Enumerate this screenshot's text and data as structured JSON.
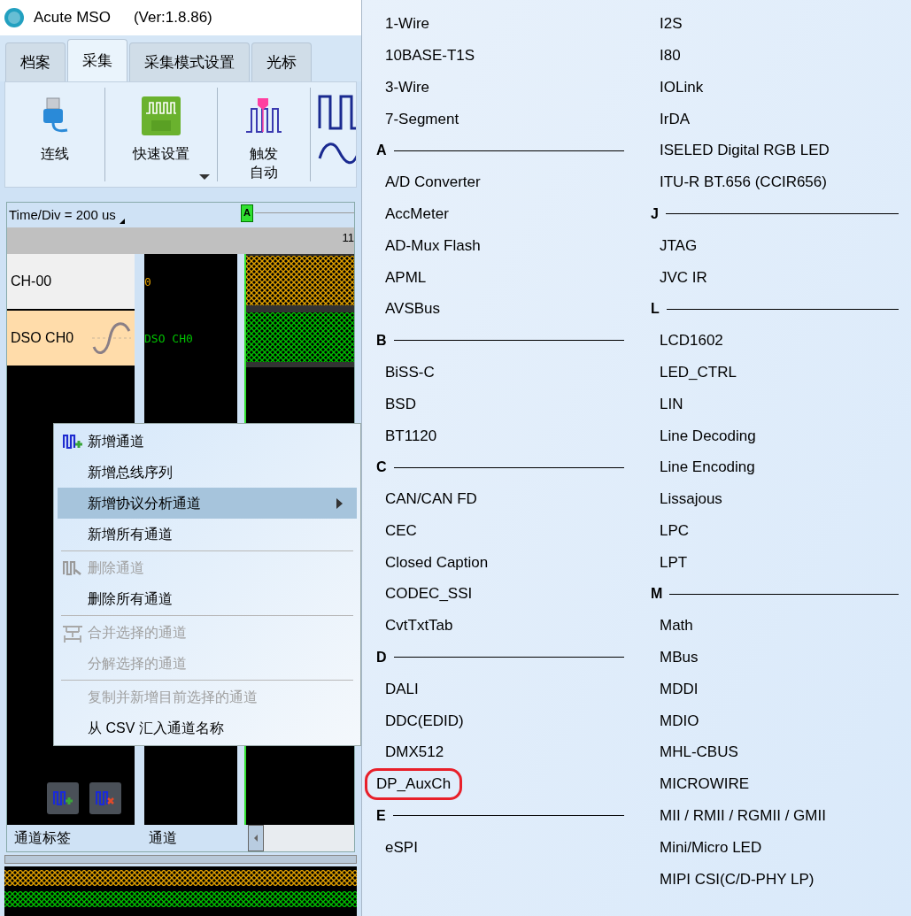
{
  "window": {
    "app_name": "Acute MSO",
    "version": "(Ver:1.8.86)"
  },
  "tabs": [
    {
      "label": "档案",
      "selected": false
    },
    {
      "label": "采集",
      "selected": true
    },
    {
      "label": "采集模式设置",
      "selected": false
    },
    {
      "label": "光标",
      "selected": false
    }
  ],
  "ribbon": [
    {
      "lines": [
        "连线"
      ],
      "has_dropdown": false
    },
    {
      "lines": [
        "快速设置"
      ],
      "has_dropdown": true
    },
    {
      "lines": [
        "触发",
        "自动"
      ],
      "has_dropdown": false
    }
  ],
  "scope": {
    "time_div": "Time/Div = 200 us",
    "ruler_label": "11",
    "marker": "A",
    "channels": [
      {
        "label": "CH-00",
        "kind": "digital",
        "name": "0",
        "color": "#e0a000",
        "selected": false
      },
      {
        "label": "DSO CH0",
        "kind": "analog",
        "name": "DSO CH0",
        "color": "#00c000",
        "selected": true
      }
    ],
    "footer": {
      "column_1": "通道标签",
      "column_2": "通道"
    }
  },
  "context_menu": [
    {
      "kind": "item",
      "label": "新增通道",
      "has_icon": true,
      "disabled": false,
      "selected": false,
      "has_submenu": false
    },
    {
      "kind": "item",
      "label": "新增总线序列",
      "has_icon": false,
      "disabled": false,
      "selected": false,
      "has_submenu": false
    },
    {
      "kind": "item",
      "label": "新增协议分析通道",
      "has_icon": false,
      "disabled": false,
      "selected": true,
      "has_submenu": true
    },
    {
      "kind": "item",
      "label": "新增所有通道",
      "has_icon": false,
      "disabled": false,
      "selected": false,
      "has_submenu": false
    },
    {
      "kind": "separator"
    },
    {
      "kind": "item",
      "label": "删除通道",
      "has_icon": true,
      "disabled": true,
      "selected": false,
      "has_submenu": false
    },
    {
      "kind": "item",
      "label": "删除所有通道",
      "has_icon": false,
      "disabled": false,
      "selected": false,
      "has_submenu": false
    },
    {
      "kind": "separator"
    },
    {
      "kind": "item",
      "label": "合并选择的通道",
      "has_icon": true,
      "disabled": true,
      "selected": false,
      "has_submenu": false
    },
    {
      "kind": "item",
      "label": "分解选择的通道",
      "has_icon": false,
      "disabled": true,
      "selected": false,
      "has_submenu": false
    },
    {
      "kind": "separator"
    },
    {
      "kind": "item",
      "label": "复制并新增目前选择的通道",
      "has_icon": false,
      "disabled": true,
      "selected": false,
      "has_submenu": false
    },
    {
      "kind": "item",
      "label": "从 CSV 汇入通道名称",
      "has_icon": false,
      "disabled": false,
      "selected": false,
      "has_submenu": false
    }
  ],
  "submenu": {
    "columns": [
      {
        "entries": [
          {
            "kind": "item",
            "label": "1-Wire",
            "circled": false
          },
          {
            "kind": "item",
            "label": "10BASE-T1S",
            "circled": false
          },
          {
            "kind": "item",
            "label": "3-Wire",
            "circled": false
          },
          {
            "kind": "item",
            "label": "7-Segment",
            "circled": false
          },
          {
            "kind": "header",
            "label": "A"
          },
          {
            "kind": "item",
            "label": "A/D Converter",
            "circled": false
          },
          {
            "kind": "item",
            "label": "AccMeter",
            "circled": false
          },
          {
            "kind": "item",
            "label": "AD-Mux Flash",
            "circled": false
          },
          {
            "kind": "item",
            "label": "APML",
            "circled": false
          },
          {
            "kind": "item",
            "label": "AVSBus",
            "circled": false
          },
          {
            "kind": "header",
            "label": "B"
          },
          {
            "kind": "item",
            "label": "BiSS-C",
            "circled": false
          },
          {
            "kind": "item",
            "label": "BSD",
            "circled": false
          },
          {
            "kind": "item",
            "label": "BT1120",
            "circled": false
          },
          {
            "kind": "header",
            "label": "C"
          },
          {
            "kind": "item",
            "label": "CAN/CAN FD",
            "circled": false
          },
          {
            "kind": "item",
            "label": "CEC",
            "circled": false
          },
          {
            "kind": "item",
            "label": "Closed Caption",
            "circled": false
          },
          {
            "kind": "item",
            "label": "CODEC_SSI",
            "circled": false
          },
          {
            "kind": "item",
            "label": "CvtTxtTab",
            "circled": false
          },
          {
            "kind": "header",
            "label": "D"
          },
          {
            "kind": "item",
            "label": "DALI",
            "circled": false
          },
          {
            "kind": "item",
            "label": "DDC(EDID)",
            "circled": false
          },
          {
            "kind": "item",
            "label": "DMX512",
            "circled": false
          },
          {
            "kind": "item",
            "label": "DP_AuxCh",
            "circled": true
          },
          {
            "kind": "header",
            "label": "E"
          },
          {
            "kind": "item",
            "label": "eSPI",
            "circled": false
          }
        ]
      },
      {
        "entries": [
          {
            "kind": "item",
            "label": "I2S",
            "circled": false
          },
          {
            "kind": "item",
            "label": "I80",
            "circled": false
          },
          {
            "kind": "item",
            "label": "IOLink",
            "circled": false
          },
          {
            "kind": "item",
            "label": "IrDA",
            "circled": false
          },
          {
            "kind": "item",
            "label": "ISELED Digital RGB LED",
            "circled": false
          },
          {
            "kind": "item",
            "label": "ITU-R BT.656 (CCIR656)",
            "circled": false
          },
          {
            "kind": "header",
            "label": "J"
          },
          {
            "kind": "item",
            "label": "JTAG",
            "circled": false
          },
          {
            "kind": "item",
            "label": "JVC IR",
            "circled": false
          },
          {
            "kind": "header",
            "label": "L"
          },
          {
            "kind": "item",
            "label": "LCD1602",
            "circled": false
          },
          {
            "kind": "item",
            "label": "LED_CTRL",
            "circled": false
          },
          {
            "kind": "item",
            "label": "LIN",
            "circled": false
          },
          {
            "kind": "item",
            "label": "Line Decoding",
            "circled": false
          },
          {
            "kind": "item",
            "label": "Line Encoding",
            "circled": false
          },
          {
            "kind": "item",
            "label": "Lissajous",
            "circled": false
          },
          {
            "kind": "item",
            "label": "LPC",
            "circled": false
          },
          {
            "kind": "item",
            "label": "LPT",
            "circled": false
          },
          {
            "kind": "header",
            "label": "M"
          },
          {
            "kind": "item",
            "label": "Math",
            "circled": false
          },
          {
            "kind": "item",
            "label": "MBus",
            "circled": false
          },
          {
            "kind": "item",
            "label": "MDDI",
            "circled": false
          },
          {
            "kind": "item",
            "label": "MDIO",
            "circled": false
          },
          {
            "kind": "item",
            "label": "MHL-CBUS",
            "circled": false
          },
          {
            "kind": "item",
            "label": "MICROWIRE",
            "circled": false
          },
          {
            "kind": "item",
            "label": "MII / RMII / RGMII / GMII",
            "circled": false
          },
          {
            "kind": "item",
            "label": "Mini/Micro LED",
            "circled": false
          },
          {
            "kind": "item",
            "label": "MIPI CSI(C/D-PHY LP)",
            "circled": false
          }
        ]
      }
    ]
  }
}
